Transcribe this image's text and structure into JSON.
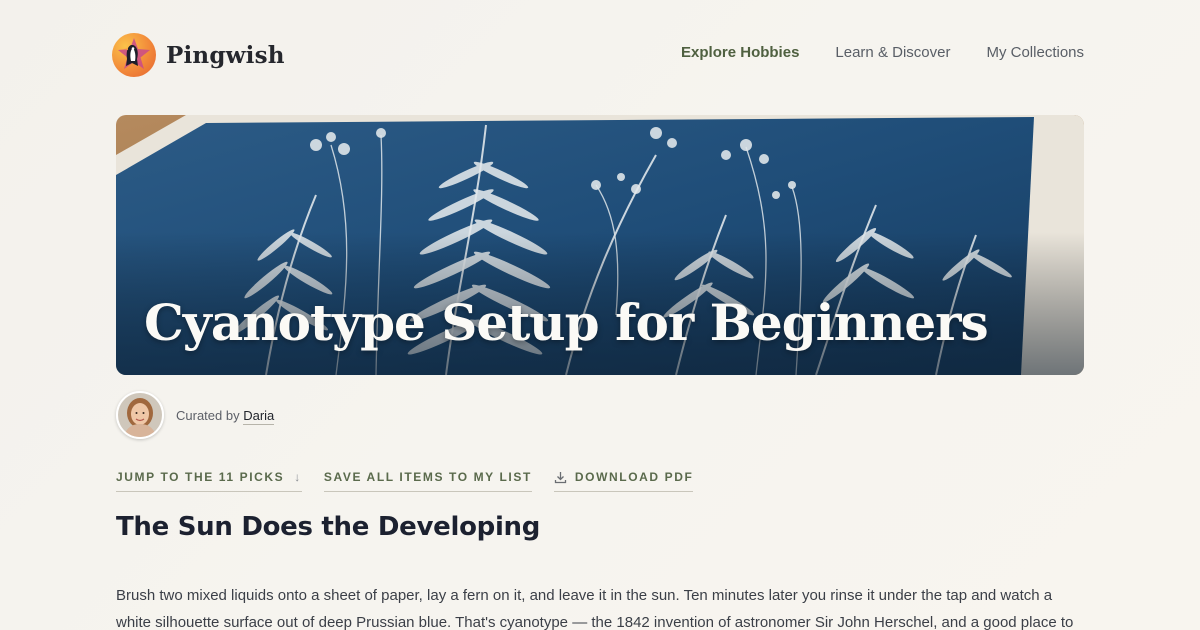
{
  "brand": {
    "name": "Pingwish"
  },
  "nav": {
    "items": [
      {
        "label": "Explore Hobbies",
        "active": true
      },
      {
        "label": "Learn & Discover",
        "active": false
      },
      {
        "label": "My Collections",
        "active": false
      }
    ]
  },
  "hero": {
    "title": "Cyanotype Setup for Beginners"
  },
  "curator": {
    "prefix": "Curated by",
    "name": "Daria"
  },
  "actions": {
    "jump": "JUMP TO THE 11 PICKS",
    "jump_arrow": "↓",
    "save": "SAVE ALL ITEMS TO MY LIST",
    "download": "DOWNLOAD PDF"
  },
  "article": {
    "heading": "The Sun Does the Developing",
    "paragraph": "Brush two mixed liquids onto a sheet of paper, lay a fern on it, and leave it in the sun. Ten minutes later you rinse it under the tap and watch a white silhouette surface out of deep Prussian blue. That's cyanotype — the 1842 invention of astronomer Sir John Herschel, and a good place to"
  },
  "colors": {
    "accent": "#5a6a4c",
    "prussian_blue": "#1e4a72",
    "text": "#1c2130"
  }
}
